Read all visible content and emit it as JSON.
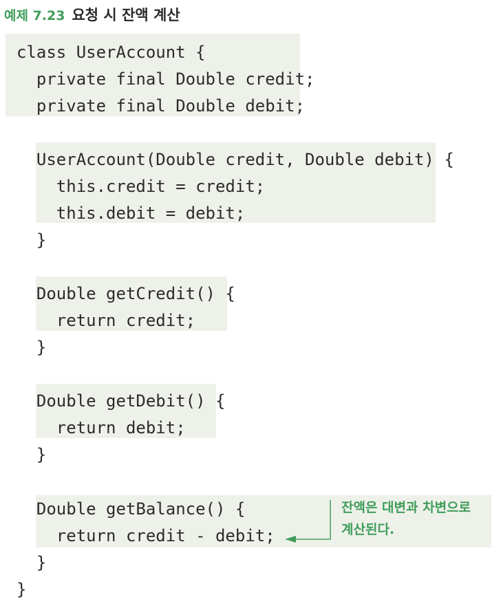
{
  "caption": {
    "number": "예제 7.23",
    "title": "요청 시 잔액 계산"
  },
  "code": [
    "class UserAccount {",
    "  private final Double credit;",
    "  private final Double debit;",
    "",
    "  UserAccount(Double credit, Double debit) {",
    "    this.credit = credit;",
    "    this.debit = debit;",
    "  }",
    "",
    "  Double getCredit() {",
    "    return credit;",
    "  }",
    "",
    "  Double getDebit() {",
    "    return debit;",
    "  }",
    "",
    "  Double getBalance() {",
    "    return credit - debit;",
    "  }",
    "}"
  ],
  "annotation": {
    "line1": "잔액은 대변과 차변으로",
    "line2": "계산된다.",
    "color": "#3f9d5a"
  },
  "colors": {
    "highlight": "#eef1ea",
    "code_text": "#2b2b2b",
    "accent": "#3f9d5a"
  }
}
